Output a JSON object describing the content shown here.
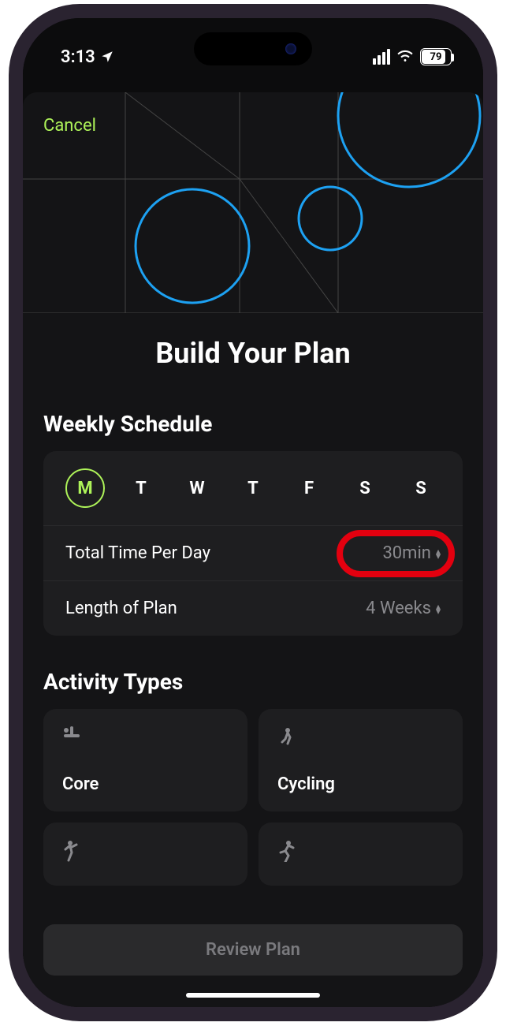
{
  "status": {
    "time": "3:13",
    "battery_pct": "79"
  },
  "nav": {
    "cancel": "Cancel"
  },
  "title": "Build Your Plan",
  "schedule": {
    "header": "Weekly Schedule",
    "days": [
      "M",
      "T",
      "W",
      "T",
      "F",
      "S",
      "S"
    ],
    "selected_index": 0,
    "total_time_label": "Total Time Per Day",
    "total_time_value": "30min",
    "length_label": "Length of Plan",
    "length_value": "4 Weeks"
  },
  "activities": {
    "header": "Activity Types",
    "items": [
      {
        "label": "Core",
        "icon": "core-icon"
      },
      {
        "label": "Cycling",
        "icon": "cycling-icon"
      },
      {
        "label": "",
        "icon": "dance-icon"
      },
      {
        "label": "",
        "icon": "running-icon"
      }
    ]
  },
  "footer": {
    "review": "Review Plan"
  }
}
